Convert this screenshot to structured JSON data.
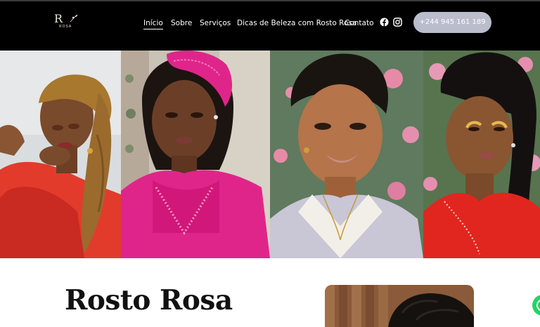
{
  "header": {
    "logo": {
      "mark": "R",
      "sub": "ROSA"
    },
    "nav": [
      {
        "label": "Início",
        "active": true
      },
      {
        "label": "Sobre"
      },
      {
        "label": "Serviços"
      },
      {
        "label": "Dicas de Beleza com Rosto Rosa"
      },
      {
        "label": "Contato"
      }
    ],
    "social_icons": [
      "facebook-icon",
      "instagram-icon"
    ],
    "phone_button": "+244 945 161 189",
    "phone_button_color": "#b9bdcc"
  },
  "hero": {
    "slides": 4,
    "active_slide": 4
  },
  "section": {
    "title": "Rosto Rosa"
  },
  "colors": {
    "header_bg": "#000000",
    "accent_pink": "#e0258a",
    "whatsapp_green": "#25d366"
  }
}
